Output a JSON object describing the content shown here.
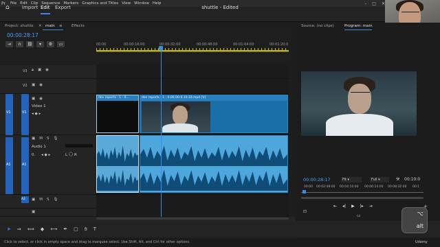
{
  "menubar": {
    "items": [
      "File",
      "Edit",
      "Clip",
      "Sequence",
      "Markers",
      "Graphics and Titles",
      "View",
      "Window",
      "Help"
    ],
    "controls": [
      "–",
      "□",
      "✕"
    ]
  },
  "header": {
    "tabs": [
      "Import",
      "Edit",
      "Export"
    ],
    "active_tab": "Edit",
    "title": "shuttle - Edited"
  },
  "left_panel": {
    "tabs": [
      "Project: shuttle",
      "main",
      "Effects"
    ],
    "active_tab": "main",
    "timecode": "00:00:28:17",
    "ruler_labels": [
      "00:00",
      "00:00:16:00",
      "00:00:32:00",
      "00:00:48:00",
      "00:01:04:00",
      "00:01:20:0"
    ],
    "tracks": {
      "v3": "V3",
      "v2": "V2",
      "v1": "V1",
      "v1_target": "V1",
      "v1_name": "Video 1",
      "a1": "A1",
      "a1_target": "A1",
      "a1_name": "Audio 1",
      "a1_vol": "0.",
      "a1_pan": "L",
      "a1_pan_r": "R",
      "a2": "A2",
      "a2_mute": "M",
      "a2_solo": "S",
      "a1_mute": "M",
      "a1_solo": "S"
    },
    "clips": {
      "clip1": "dev reports - 1 - 0...",
      "clip2": "dev reports - 1 - 0.00.00-0.10.10.mp4 [V]"
    }
  },
  "right_panel": {
    "source_tab": "Source: (no clips)",
    "program_tab": "Program: main",
    "timecode": "00:00:28:17",
    "fit": "Fit",
    "quality": "Full",
    "duration": "00:10:0",
    "mini_ruler": [
      "00:00",
      "00:02:08:00",
      "00:04:16:00",
      "00:06:24:00",
      "00:08:32:00",
      "00:1"
    ]
  },
  "status": {
    "text": "Click to select, or click in empty space and drag to marquee select. Use Shift, Alt, and Ctrl for other options.",
    "brand": "Udemy"
  },
  "alt_key": {
    "symbol": "⌥",
    "label": "alt"
  },
  "colors": {
    "accent": "#3d8be8",
    "timecode": "#4ba0ff",
    "video_clip": "#1a6fa8",
    "audio_clip": "#4ea7dc"
  }
}
